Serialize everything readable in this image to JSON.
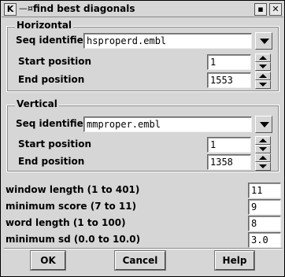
{
  "window": {
    "title": "find best diagonals"
  },
  "titlebar": {
    "app_icon": "K",
    "pin_icon": "pin-icon",
    "min_icon": "minimize-icon",
    "close_icon": "close-icon",
    "min_glyph": "▪",
    "close_glyph": "✕"
  },
  "horizontal": {
    "group_title": "Horizontal",
    "seq_label": "Seq identifier",
    "seq_value": "hsproperd.embl",
    "start_label": "Start position",
    "start_value": "1",
    "end_label": "End position",
    "end_value": "1553"
  },
  "vertical": {
    "group_title": "Vertical",
    "seq_label": "Seq identifier",
    "seq_value": "mmproper.embl",
    "start_label": "Start position",
    "start_value": "1",
    "end_label": "End position",
    "end_value": "1358"
  },
  "params": {
    "window_length_label": "window length (1 to 401)",
    "window_length_value": "11",
    "min_score_label": "minimum score (7 to 11)",
    "min_score_value": "9",
    "word_length_label": "word length (1  to 100)",
    "word_length_value": "8",
    "min_sd_label": "minimum sd (0.0 to  10.0)",
    "min_sd_value": "3.0"
  },
  "buttons": {
    "ok": "OK",
    "cancel": "Cancel",
    "help": "Help"
  }
}
